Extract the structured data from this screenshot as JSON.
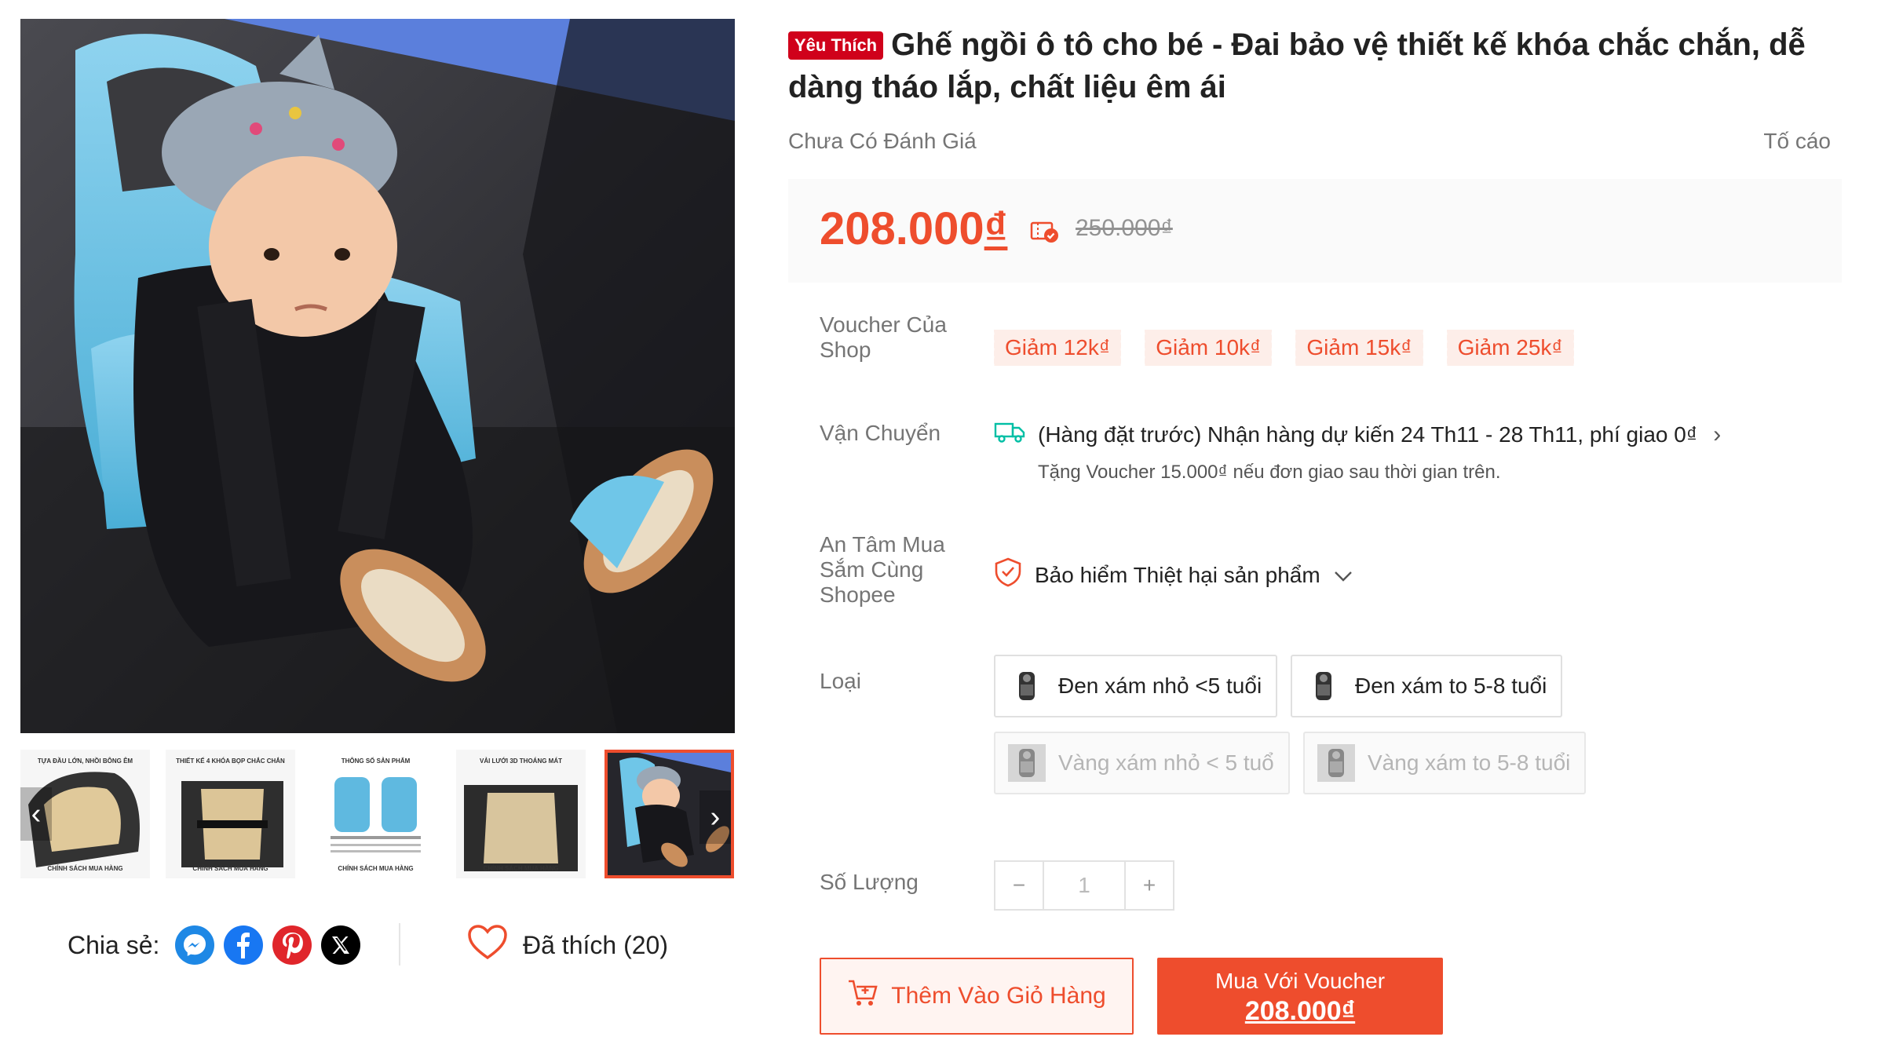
{
  "gallery": {
    "thumbnails": [
      {
        "caption_top": "TỰA ĐẦU LỚN, NHỒI BÔNG ÊM",
        "caption_bottom": "CHÍNH SÁCH MUA HÀNG"
      },
      {
        "caption_top": "THIẾT KẾ 4 KHÓA BỌP CHẮC CHẮN",
        "caption_bottom": "CHÍNH SÁCH MUA HÀNG"
      },
      {
        "caption_top": "THÔNG SỐ SẢN PHẨM",
        "caption_bottom": "CHÍNH SÁCH MUA HÀNG"
      },
      {
        "caption_top": "VẢI LƯỚI 3D THOÁNG MÁT",
        "caption_bottom": "CHÍNH SÁCH MUA HÀNG"
      },
      {
        "caption_top": "",
        "caption_bottom": ""
      }
    ],
    "prev_icon": "chevron-left-icon",
    "next_icon": "chevron-right-icon"
  },
  "share": {
    "label": "Chia sẻ:",
    "icons": [
      "messenger-icon",
      "facebook-icon",
      "pinterest-icon",
      "x-icon"
    ]
  },
  "like": {
    "label": "Đã thích (20)",
    "icon": "heart-icon"
  },
  "product": {
    "badge": "Yêu Thích",
    "title": "Ghế ngồi ô tô cho bé - Đai bảo vệ thiết kế khóa chắc chắn, dễ dàng tháo lắp, chất liệu êm ái",
    "rating_text": "Chưa Có Đánh Giá",
    "report_text": "Tố cáo"
  },
  "price": {
    "current": "208.000",
    "currency": "₫",
    "original": "250.000₫"
  },
  "vouchers": {
    "label": "Voucher Của Shop",
    "items": [
      "Giảm 12k₫",
      "Giảm 10k₫",
      "Giảm 15k₫",
      "Giảm 25k₫"
    ]
  },
  "shipping": {
    "label": "Vận Chuyển",
    "text": "(Hàng đặt trước) Nhận hàng dự kiến 24 Th11 - 28 Th11, phí giao 0₫",
    "sub": "Tặng Voucher 15.000₫ nếu đơn giao sau thời gian trên."
  },
  "assurance": {
    "label": "An Tâm Mua Sắm Cùng Shopee",
    "text": "Bảo hiểm Thiệt hại sản phẩm"
  },
  "variants": {
    "label": "Loại",
    "options": [
      {
        "label": "Đen xám nhỏ <5 tuổi",
        "available": true
      },
      {
        "label": "Đen xám to 5-8 tuổi",
        "available": true
      },
      {
        "label": "Vàng xám nhỏ < 5 tuổ",
        "available": false
      },
      {
        "label": "Vàng xám to 5-8 tuổi",
        "available": false
      }
    ]
  },
  "quantity": {
    "label": "Số Lượng",
    "value": "1",
    "minus": "−",
    "plus": "+"
  },
  "actions": {
    "add_to_cart": "Thêm Vào Giỏ Hàng",
    "buy_line1": "Mua Với Voucher",
    "buy_line2": "208.000₫"
  },
  "colors": {
    "accent": "#ee4d2d",
    "badge": "#d0011b",
    "price_bg": "#fafafa"
  }
}
